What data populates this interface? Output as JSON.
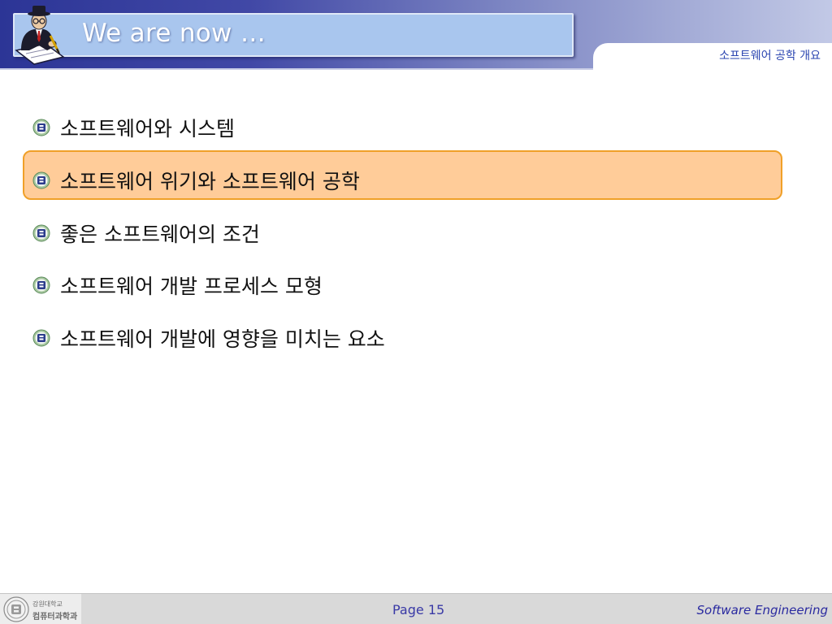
{
  "header": {
    "title": "We are now …",
    "section_label": "소프트웨어 공학 개요"
  },
  "agenda": {
    "items": [
      {
        "label": "소프트웨어와 시스템",
        "highlighted": false
      },
      {
        "label": "소프트웨어 위기와 소프트웨어 공학",
        "highlighted": true
      },
      {
        "label": "좋은 소프트웨어의 조건",
        "highlighted": false
      },
      {
        "label": "소프트웨어 개발 프로세스 모형",
        "highlighted": false
      },
      {
        "label": "소프트웨어 개발에 영향을 미치는 요소",
        "highlighted": false
      }
    ],
    "bullet_icon": "university-emblem-icon"
  },
  "footer": {
    "university": "강원대학교",
    "department": "컴퓨터과학과",
    "page_label": "Page 15",
    "course": "Software Engineering"
  },
  "colors": {
    "header_dark": "#2c3596",
    "title_box": "#a9c6ee",
    "highlight_fill": "#ffcc99",
    "highlight_border": "#f0a028",
    "section_label": "#2a44b0",
    "page_number": "#3a3aa6"
  }
}
